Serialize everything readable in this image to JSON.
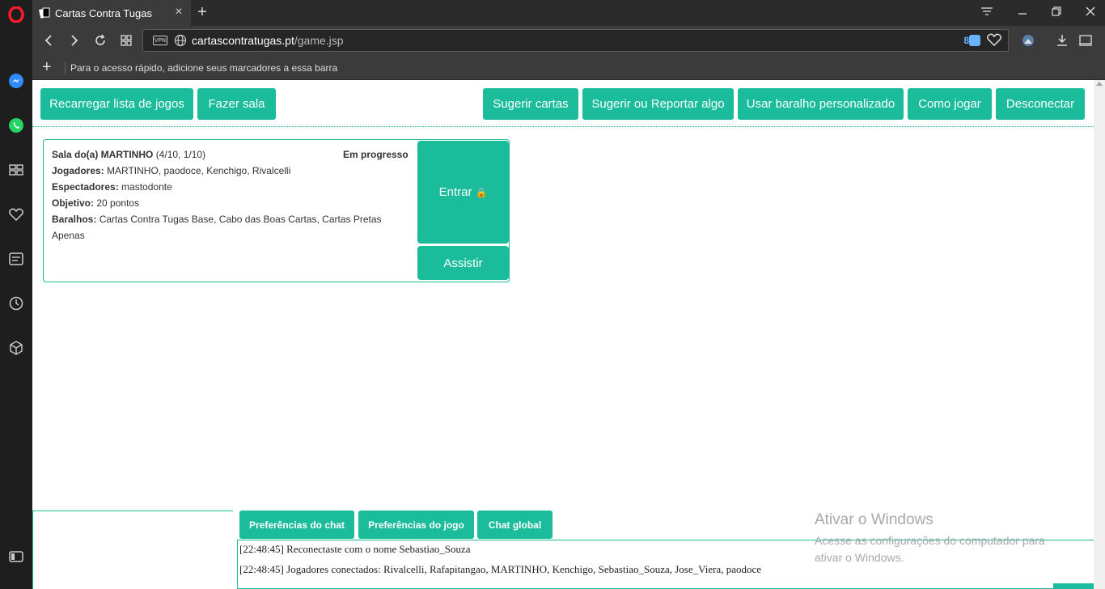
{
  "browser": {
    "tab_title": "Cartas Contra Tugas",
    "url_domain": "cartascontratugas.pt",
    "url_path": "/game.jsp",
    "vpn_label": "VPN",
    "adblock_count": "8",
    "bookmarks_hint": "Para o acesso rápido, adicione seus marcadores a essa barra"
  },
  "sidebar": {
    "icons": [
      "opera-logo-icon",
      "messenger-icon",
      "whatsapp-icon",
      "speed-dial-icon",
      "heart-icon",
      "news-icon",
      "history-icon",
      "extensions-icon",
      "sidebar-toggle-icon"
    ]
  },
  "toolbar": {
    "reload_games": "Recarregar lista de jogos",
    "make_room": "Fazer sala",
    "suggest_cards": "Sugerir cartas",
    "suggest_report": "Sugerir ou Reportar algo",
    "custom_deck": "Usar baralho personalizado",
    "how_to_play": "Como jogar",
    "disconnect": "Desconectar"
  },
  "game": {
    "room_label": "Sala do(a) MARTINHO",
    "room_counts": "(4/10, 1/10)",
    "status": "Em progresso",
    "players_label": "Jogadores:",
    "players": "MARTINHO, paodoce, Kenchigo, Rivalcelli",
    "spectators_label": "Espectadores:",
    "spectators": "mastodonte",
    "goal_label": "Objetivo:",
    "goal": "20 pontos",
    "decks_label": "Baralhos:",
    "decks": "Cartas Contra Tugas Base, Cabo das Boas Cartas, Cartas Pretas Apenas",
    "enter": "Entrar",
    "lock_icon": "lock-icon",
    "watch": "Assistir"
  },
  "chat": {
    "tabs": [
      "Preferências do chat",
      "Preferências do jogo",
      "Chat global"
    ],
    "messages": [
      "[22:48:45] Reconectaste com o nome Sebastiao_Souza",
      "[22:48:45] Jogadores conectados: Rivalcelli, Rafapitangao, MARTINHO, Kenchigo, Sebastiao_Souza, Jose_Viera, paodoce"
    ]
  },
  "watermark": {
    "title": "Ativar o Windows",
    "subtitle": "Acesse as configurações do computador para ativar o Windows."
  },
  "colors": {
    "accent": "#1abc9c",
    "chrome_dark": "#2b2b2b",
    "chrome_mid": "#3b3b3b",
    "sidebar": "#1e1e1e"
  }
}
